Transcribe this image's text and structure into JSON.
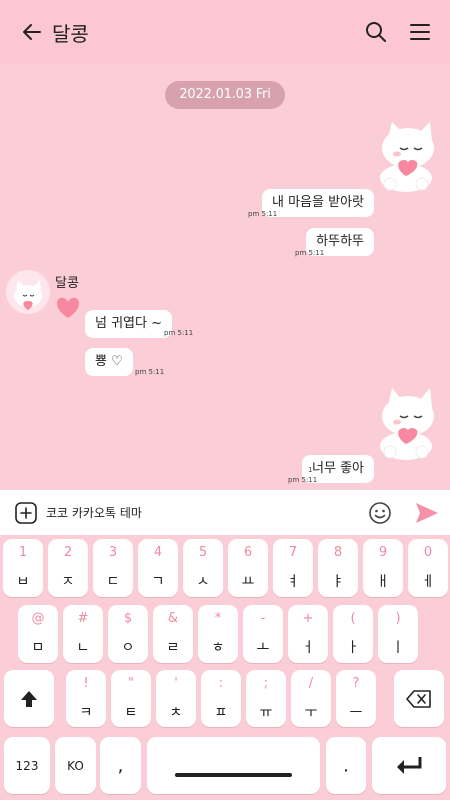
{
  "header": {
    "title": "달콩"
  },
  "chat": {
    "date": "2022.01.03 Fri",
    "messages": [
      {
        "side": "right",
        "text": "내 마음을 받아랏",
        "time": "pm 5:11"
      },
      {
        "side": "right",
        "text": "하뚜하뚜",
        "time": "pm 5:11"
      },
      {
        "side": "left",
        "sender": "달콩",
        "text": "넘 귀엽다 ~",
        "time": "pm 5:11"
      },
      {
        "side": "left",
        "text": "뿅 ♡",
        "time": "pm 5:11"
      },
      {
        "side": "right",
        "text": "너무 좋아",
        "time": "pm 5:11",
        "unread": "1"
      }
    ]
  },
  "input": {
    "text": "코코 카카오톡 테마"
  },
  "keyboard": {
    "row1": [
      {
        "hint": "1",
        "main": "ㅂ"
      },
      {
        "hint": "2",
        "main": "ㅈ"
      },
      {
        "hint": "3",
        "main": "ㄷ"
      },
      {
        "hint": "4",
        "main": "ㄱ"
      },
      {
        "hint": "5",
        "main": "ㅅ"
      },
      {
        "hint": "6",
        "main": "ㅛ"
      },
      {
        "hint": "7",
        "main": "ㅕ"
      },
      {
        "hint": "8",
        "main": "ㅑ"
      },
      {
        "hint": "9",
        "main": "ㅐ"
      },
      {
        "hint": "0",
        "main": "ㅔ"
      }
    ],
    "row2": [
      {
        "hint": "@",
        "main": "ㅁ"
      },
      {
        "hint": "#",
        "main": "ㄴ"
      },
      {
        "hint": "$",
        "main": "ㅇ"
      },
      {
        "hint": "&",
        "main": "ㄹ"
      },
      {
        "hint": "*",
        "main": "ㅎ"
      },
      {
        "hint": "-",
        "main": "ㅗ"
      },
      {
        "hint": "+",
        "main": "ㅓ"
      },
      {
        "hint": "(",
        "main": "ㅏ"
      },
      {
        "hint": ")",
        "main": "ㅣ"
      }
    ],
    "row3": [
      {
        "hint": "!",
        "main": "ㅋ"
      },
      {
        "hint": "\"",
        "main": "ㅌ"
      },
      {
        "hint": "'",
        "main": "ㅊ"
      },
      {
        "hint": ":",
        "main": "ㅍ"
      },
      {
        "hint": ";",
        "main": "ㅠ"
      },
      {
        "hint": "/",
        "main": "ㅜ"
      },
      {
        "hint": "?",
        "main": "ㅡ"
      }
    ],
    "num_label": "123",
    "lang_label": "KO",
    "comma": ",",
    "period": "."
  },
  "icons": [
    "back-arrow-icon",
    "search-icon",
    "menu-icon",
    "plus-box-icon",
    "emoji-icon",
    "send-icon",
    "shift-icon",
    "backspace-icon",
    "enter-icon"
  ],
  "colors": {
    "background": "#fbcdd6",
    "accent": "#f08aa0",
    "date_pill": "#d7a2ad"
  }
}
